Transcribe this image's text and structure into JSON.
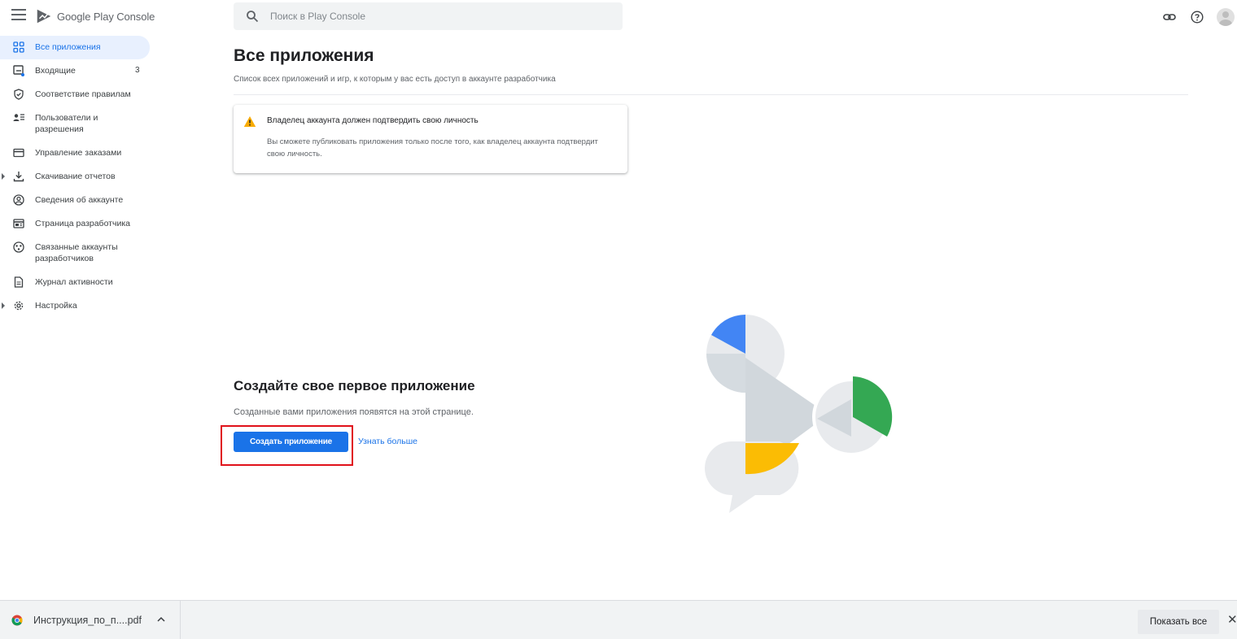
{
  "header": {
    "brand_primary": "Google Play",
    "brand_secondary": "Console",
    "search_placeholder": "Поиск в Play Console"
  },
  "sidebar": {
    "items": [
      {
        "label": "Все приложения",
        "icon": "grid-icon",
        "active": true
      },
      {
        "label": "Входящие",
        "icon": "inbox-icon",
        "badge": "3"
      },
      {
        "label": "Соответствие правилам",
        "icon": "shield-icon"
      },
      {
        "label": "Пользователи и разрешения",
        "icon": "users-icon"
      },
      {
        "label": "Управление заказами",
        "icon": "card-icon"
      },
      {
        "label": "Скачивание отчетов",
        "icon": "download-icon",
        "expandable": true
      },
      {
        "label": "Сведения об аккаунте",
        "icon": "account-icon"
      },
      {
        "label": "Страница разработчика",
        "icon": "dev-page-icon"
      },
      {
        "label": "Связанные аккаунты разработчиков",
        "icon": "linked-accounts-icon"
      },
      {
        "label": "Журнал активности",
        "icon": "document-icon"
      },
      {
        "label": "Настройка",
        "icon": "gear-icon",
        "expandable": true
      }
    ]
  },
  "main": {
    "title": "Все приложения",
    "subtitle": "Список всех приложений и игр, к которым у вас есть доступ в аккаунте разработчика",
    "warning": {
      "title": "Владелец аккаунта должен подтвердить свою личность",
      "body": "Вы сможете публиковать приложения только после того, как владелец аккаунта подтвердит свою личность."
    },
    "empty_state": {
      "title": "Создайте свое первое приложение",
      "subtitle": "Созданные вами приложения появятся на этой странице.",
      "create_button": "Создать приложение",
      "learn_more": "Узнать больше"
    }
  },
  "download_bar": {
    "file_name": "Инструкция_по_п....pdf",
    "show_all": "Показать все",
    "close": "✕"
  },
  "colors": {
    "accent": "#1a73e8",
    "highlight": "#e0101a",
    "illustration_blue": "#4285f4",
    "illustration_green": "#34a853",
    "illustration_yellow": "#fbbc04",
    "warning": "#f9ab00"
  }
}
